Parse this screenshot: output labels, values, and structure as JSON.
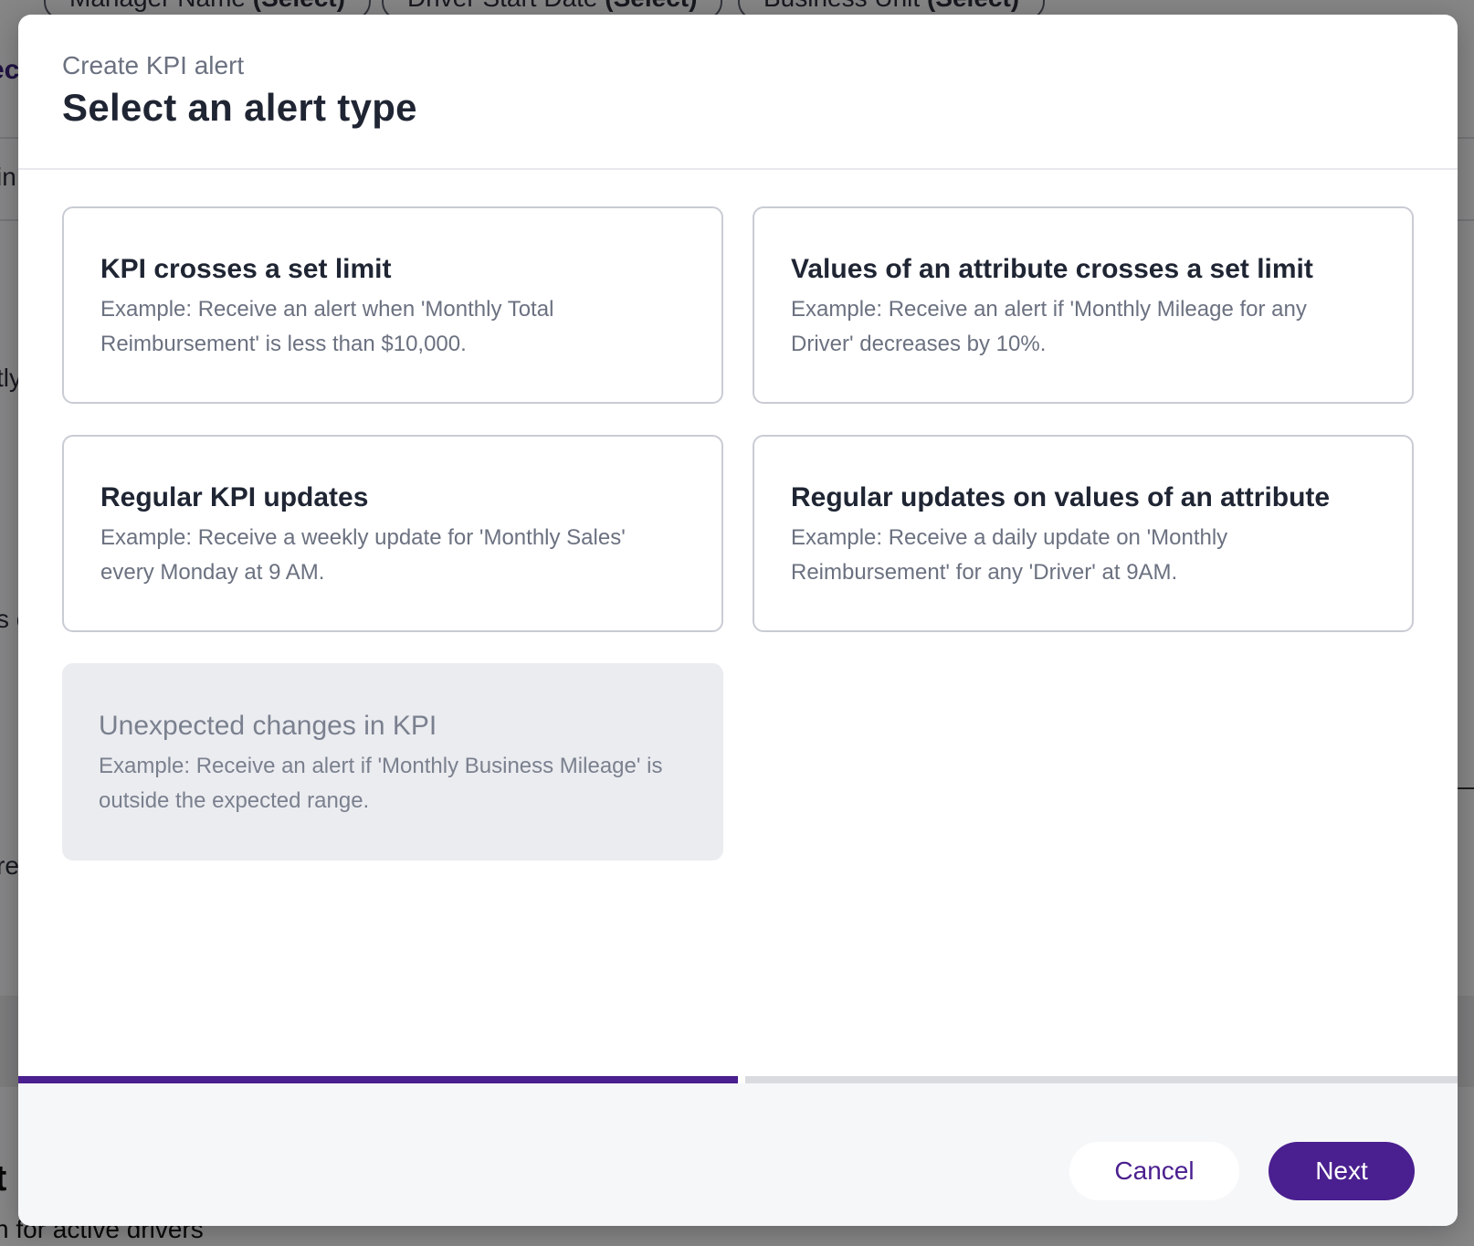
{
  "background": {
    "filters": [
      {
        "label": "Manager Name",
        "value": "(Select)"
      },
      {
        "label": "Driver Start Date",
        "value": "(Select)"
      },
      {
        "label": "Business Unit",
        "value": "(Select)"
      }
    ],
    "tab_fragment": "ec",
    "edge_texts": [
      "in",
      "tly",
      "s c",
      "re"
    ],
    "heading_fragment": "t",
    "bottom_text": "n for active drivers"
  },
  "modal": {
    "subtitle": "Create KPI alert",
    "title": "Select an alert type",
    "alert_types": [
      {
        "title": "KPI crosses a set limit",
        "description": "Example: Receive an alert when 'Monthly Total Reimbursement' is less than $10,000.",
        "enabled": true
      },
      {
        "title": "Values of an attribute crosses a set limit",
        "description": "Example: Receive an alert if 'Monthly Mileage for any Driver' decreases by 10%.",
        "enabled": true
      },
      {
        "title": "Regular KPI updates",
        "description": "Example: Receive a weekly update for 'Monthly Sales' every Monday at 9 AM.",
        "enabled": true
      },
      {
        "title": "Regular updates on values of an attribute",
        "description": "Example: Receive a daily update on 'Monthly Reimbursement' for any 'Driver' at 9AM.",
        "enabled": true
      },
      {
        "title": "Unexpected changes in KPI",
        "description": "Example: Receive an alert if 'Monthly Business Mileage' is outside the expected range.",
        "enabled": false
      }
    ],
    "progress": {
      "current_step": 1,
      "total_steps": 2
    },
    "buttons": {
      "cancel_label": "Cancel",
      "next_label": "Next"
    },
    "colors": {
      "accent": "#4a1f8f",
      "track": "#d9dbe1",
      "disabled_card": "#ebecf0"
    }
  }
}
